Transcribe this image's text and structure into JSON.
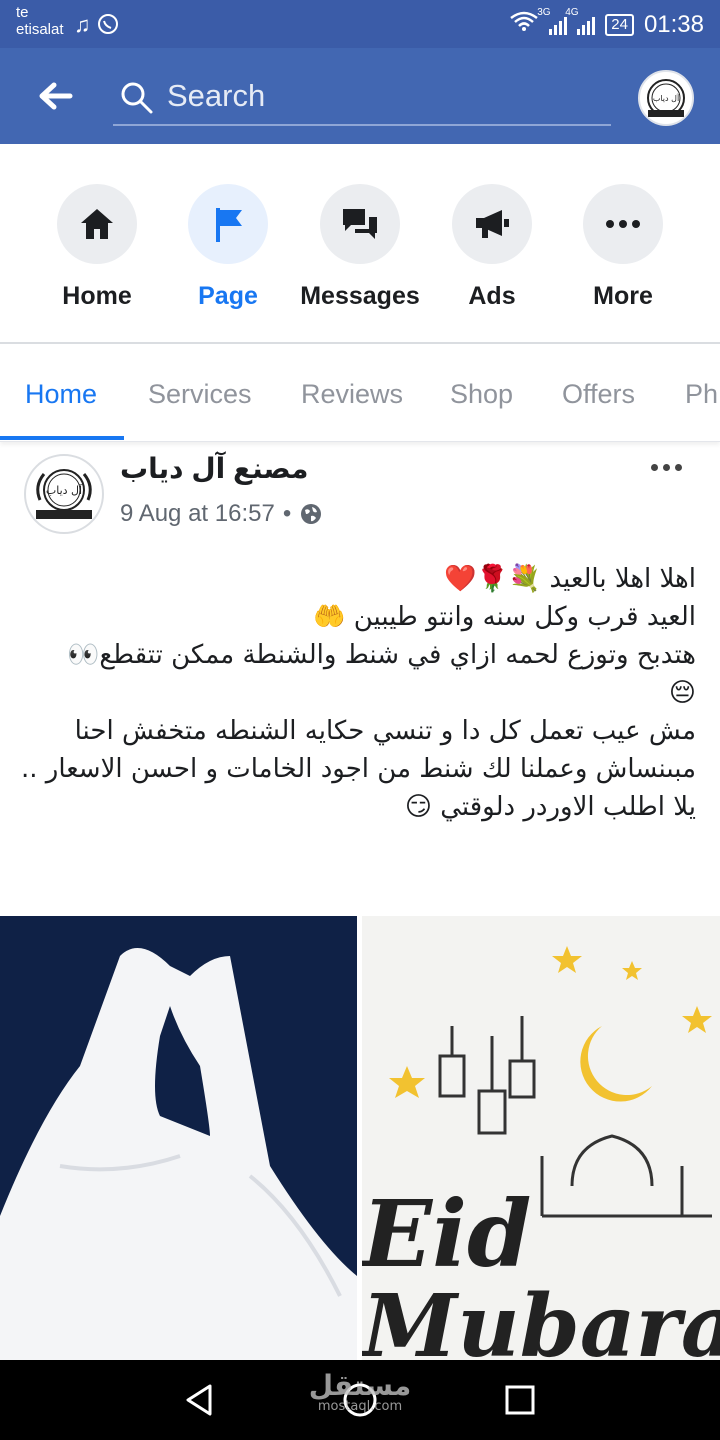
{
  "status_bar": {
    "carrier_line1": "te",
    "carrier_line2": "etisalat",
    "left_icons": [
      "music-note-icon",
      "whatsapp-icon"
    ],
    "network_1": "3G",
    "network_2": "4G",
    "battery": "24",
    "time": "01:38"
  },
  "header": {
    "search_placeholder": "Search",
    "colors": {
      "bar": "#4267b2",
      "status": "#3b5ca8"
    }
  },
  "actions": [
    {
      "label": "Home",
      "icon": "home-icon"
    },
    {
      "label": "Page",
      "icon": "flag-icon",
      "active": true
    },
    {
      "label": "Messages",
      "icon": "messages-icon"
    },
    {
      "label": "Ads",
      "icon": "megaphone-icon"
    },
    {
      "label": "More",
      "icon": "more-icon"
    }
  ],
  "tabs": [
    "Home",
    "Services",
    "Reviews",
    "Shop",
    "Offers",
    "Ph"
  ],
  "post": {
    "author": "مصنع آل دياب",
    "time": "9 Aug at 16:57",
    "separator": "•",
    "audience_icon": "globe-icon",
    "lines": [
      "اهلا اهلا بالعيد 💐🌹❤️",
      "العيد قرب وكل سنه وانتو طيبين 🤲",
      "هتدبح وتوزع لحمه ازاي في شنط والشنطة ممكن تتقطع👀",
      "😔",
      "مش عيب تعمل كل دا و تنسي حكايه الشنطه متخفش احنا مبىنساش وعملنا لك شنط من اجود الخامات و احسن الاسعار ..",
      "يلا اطلب الاوردر دلوقتي 😏"
    ]
  },
  "images": {
    "right_text_1": "Eid",
    "right_text_2": "Mubarak"
  },
  "logo_text": "آل دياب",
  "watermark": {
    "main": "مستقل",
    "sub": "mostaql.com"
  }
}
